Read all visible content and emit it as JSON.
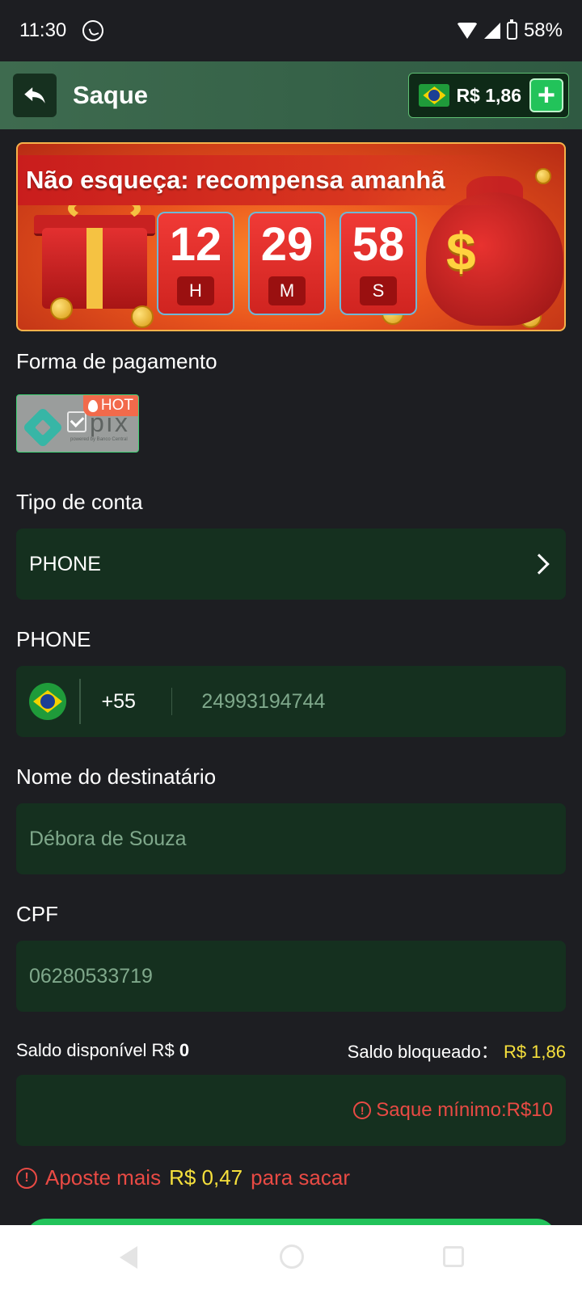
{
  "status": {
    "time": "11:30",
    "battery": "58%"
  },
  "header": {
    "title": "Saque",
    "balance": "R$ 1,86"
  },
  "banner": {
    "title": "Não esqueça: recompensa amanhã",
    "timer": [
      {
        "value": "12",
        "unit": "H"
      },
      {
        "value": "29",
        "unit": "M"
      },
      {
        "value": "58",
        "unit": "S"
      }
    ]
  },
  "payment": {
    "label": "Forma de pagamento",
    "method_text": "pix",
    "method_subtext": "powered by Banco Central",
    "badge": "HOT"
  },
  "account_type": {
    "label": "Tipo de conta",
    "value": "PHONE"
  },
  "phone": {
    "label": "PHONE",
    "country_code": "+55",
    "number": "24993194744"
  },
  "recipient": {
    "label": "Nome do destinatário",
    "value": "Débora de Souza"
  },
  "cpf": {
    "label": "CPF",
    "value": "06280533719"
  },
  "saldo": {
    "available_label": "Saldo disponível R$",
    "available_value": "0",
    "blocked_label": "Saldo bloqueado：",
    "blocked_value": "R$ 1,86"
  },
  "amount": {
    "warning": "Saque mínimo:R$10"
  },
  "bet_warning": {
    "prefix": "Aposte mais",
    "amount": "R$ 0,47",
    "suffix": "para sacar"
  },
  "colors": {
    "accent": "#22c35a",
    "warning": "#e94a44",
    "highlight": "#f6e03c",
    "field_bg": "#15301f"
  }
}
